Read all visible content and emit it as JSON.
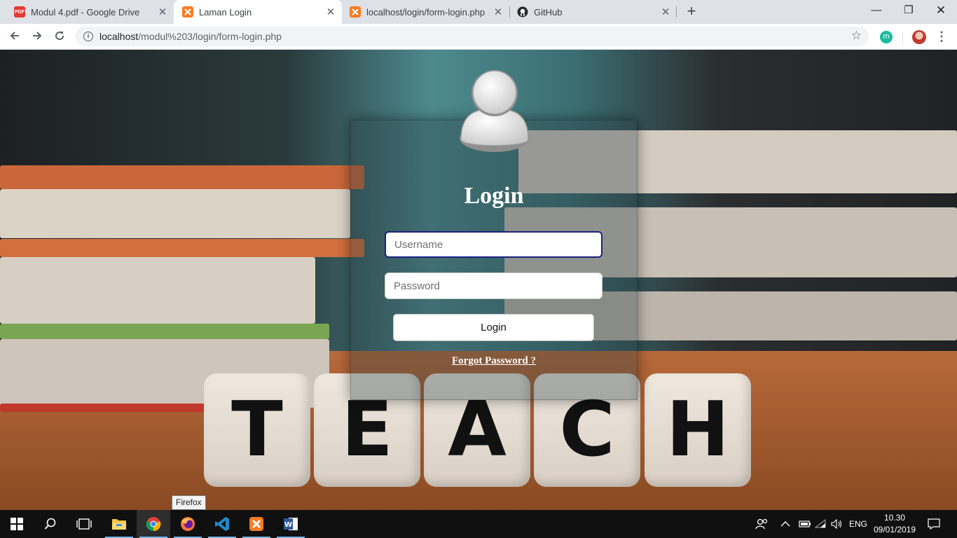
{
  "browser": {
    "tabs": [
      {
        "title": "Modul 4.pdf - Google Drive",
        "icon": "pdf-icon",
        "active": false
      },
      {
        "title": "Laman Login",
        "icon": "xampp-icon",
        "active": true
      },
      {
        "title": "localhost/login/form-login.php",
        "icon": "xampp-icon",
        "active": false
      },
      {
        "title": "GitHub",
        "icon": "github-icon",
        "active": false
      }
    ],
    "pdf_badge": "PDF",
    "url_host": "localhost",
    "url_path": "/modul%203/login/form-login.php",
    "extension_letter": "m"
  },
  "page": {
    "title": "Login",
    "username_placeholder": "Username",
    "password_placeholder": "Password",
    "login_button": "Login",
    "forgot_link": "Forgot Password ?",
    "background_letters": [
      "T",
      "E",
      "A",
      "C",
      "H"
    ]
  },
  "tooltip": "Firefox",
  "taskbar": {
    "language": "ENG",
    "time": "10.30",
    "date": "09/01/2019",
    "apps": [
      "file-explorer",
      "chrome",
      "firefox",
      "vscode",
      "xampp",
      "word"
    ]
  },
  "colors": {
    "tabstrip": "#dee1e6",
    "input_focus_border": "#1a237e",
    "taskbar": "#101010"
  }
}
